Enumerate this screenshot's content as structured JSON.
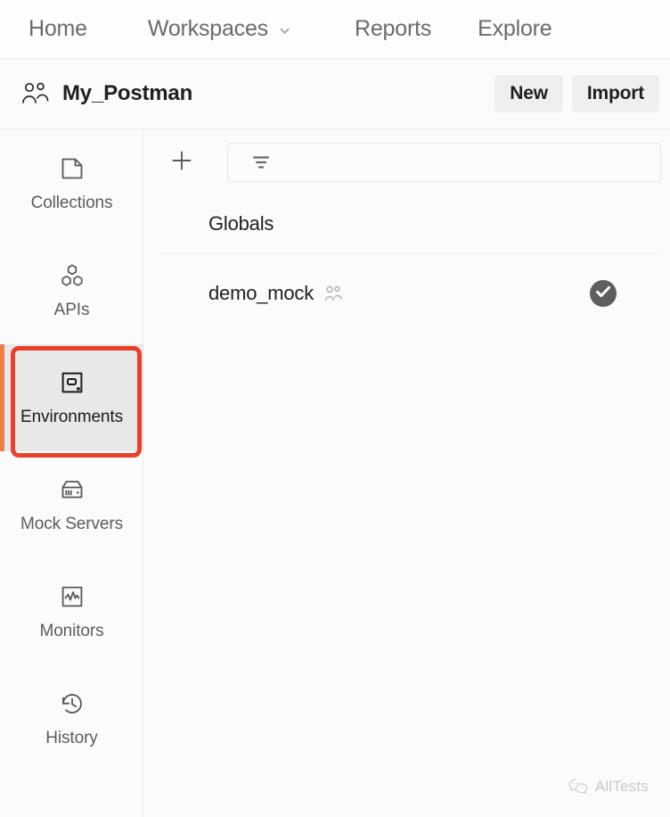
{
  "topnav": {
    "items": [
      {
        "label": "Home",
        "icon": ""
      },
      {
        "label": "Workspaces",
        "icon": "chevron-down-icon"
      },
      {
        "label": "Reports",
        "icon": ""
      },
      {
        "label": "Explore",
        "icon": ""
      }
    ]
  },
  "workspace_bar": {
    "icon": "team-icon",
    "title": "My_Postman",
    "new_label": "New",
    "import_label": "Import"
  },
  "sidebar": {
    "active": "Environments",
    "accent_color": "#f0804a",
    "items": [
      {
        "label": "Collections",
        "icon": "collections-icon"
      },
      {
        "label": "APIs",
        "icon": "apis-icon"
      },
      {
        "label": "Environments",
        "icon": "environments-icon"
      },
      {
        "label": "Mock Servers",
        "icon": "mock-servers-icon"
      },
      {
        "label": "Monitors",
        "icon": "monitors-icon"
      },
      {
        "label": "History",
        "icon": "history-icon"
      }
    ]
  },
  "annotation": {
    "target": "Environments",
    "color": "#e8402a"
  },
  "main": {
    "toolbar": {
      "add_icon": "plus-icon",
      "filter_icon": "filter-icon",
      "filter_placeholder": ""
    },
    "globals_label": "Globals",
    "environments": [
      {
        "name": "demo_mock",
        "shared_icon": "team-icon",
        "status": "active",
        "status_icon": "check-circle-icon"
      }
    ]
  },
  "watermark": {
    "icon": "wechat-icon",
    "text": "AllTests"
  }
}
